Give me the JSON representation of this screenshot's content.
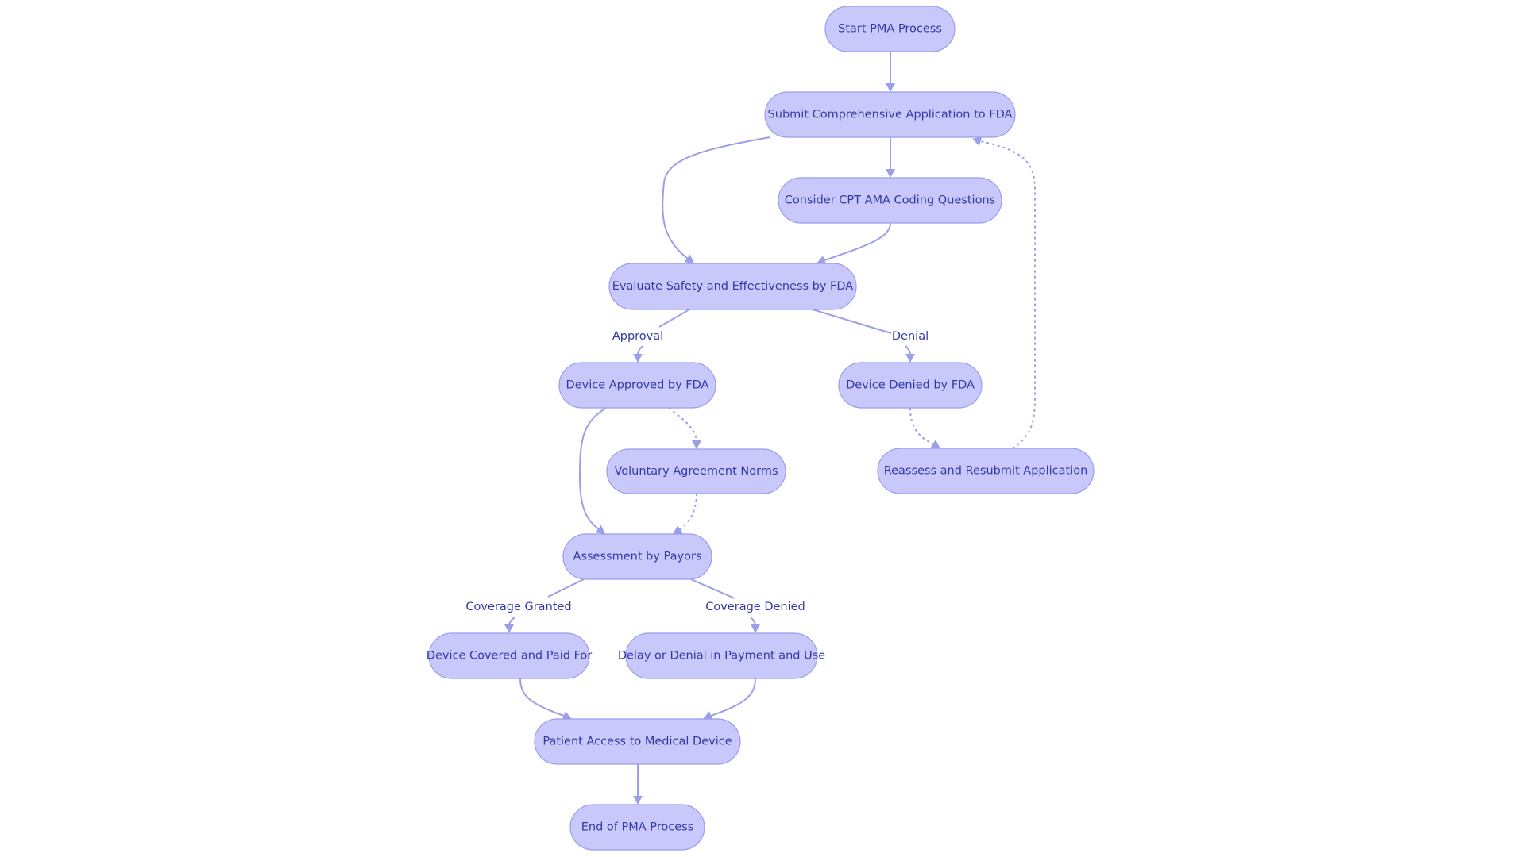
{
  "diagram": {
    "type": "flowchart",
    "direction": "top-to-bottom",
    "colors": {
      "node_fill": "#c8c9fa",
      "node_stroke": "#9b9dec",
      "node_text": "#3438a6",
      "edge": "#9c9eea"
    },
    "nodes": [
      {
        "id": "start",
        "label": "Start PMA Process"
      },
      {
        "id": "submit",
        "label": "Submit Comprehensive Application to FDA"
      },
      {
        "id": "consider",
        "label": "Consider CPT AMA Coding Questions"
      },
      {
        "id": "evaluate",
        "label": "Evaluate Safety and Effectiveness by FDA"
      },
      {
        "id": "approved",
        "label": "Device Approved by FDA"
      },
      {
        "id": "denied",
        "label": "Device Denied by FDA"
      },
      {
        "id": "voluntary",
        "label": "Voluntary Agreement Norms"
      },
      {
        "id": "reassess",
        "label": "Reassess and Resubmit Application"
      },
      {
        "id": "assessment",
        "label": "Assessment by Payors"
      },
      {
        "id": "covered",
        "label": "Device Covered and Paid For"
      },
      {
        "id": "delay",
        "label": "Delay or Denial in Payment and Use"
      },
      {
        "id": "patient",
        "label": "Patient Access to Medical Device"
      },
      {
        "id": "end",
        "label": "End of PMA Process"
      }
    ],
    "edges": [
      {
        "from": "start",
        "to": "submit",
        "label": "",
        "style": "solid"
      },
      {
        "from": "submit",
        "to": "consider",
        "label": "",
        "style": "solid"
      },
      {
        "from": "submit",
        "to": "evaluate",
        "label": "",
        "style": "solid"
      },
      {
        "from": "consider",
        "to": "evaluate",
        "label": "",
        "style": "solid"
      },
      {
        "from": "evaluate",
        "to": "approved",
        "label": "Approval",
        "style": "solid"
      },
      {
        "from": "evaluate",
        "to": "denied",
        "label": "Denial",
        "style": "solid"
      },
      {
        "from": "approved",
        "to": "voluntary",
        "label": "",
        "style": "dashed"
      },
      {
        "from": "approved",
        "to": "assessment",
        "label": "",
        "style": "solid"
      },
      {
        "from": "voluntary",
        "to": "assessment",
        "label": "",
        "style": "dashed"
      },
      {
        "from": "denied",
        "to": "reassess",
        "label": "",
        "style": "dashed"
      },
      {
        "from": "reassess",
        "to": "submit",
        "label": "",
        "style": "dashed"
      },
      {
        "from": "assessment",
        "to": "covered",
        "label": "Coverage Granted",
        "style": "solid"
      },
      {
        "from": "assessment",
        "to": "delay",
        "label": "Coverage Denied",
        "style": "solid"
      },
      {
        "from": "covered",
        "to": "patient",
        "label": "",
        "style": "solid"
      },
      {
        "from": "delay",
        "to": "patient",
        "label": "",
        "style": "solid"
      },
      {
        "from": "patient",
        "to": "end",
        "label": "",
        "style": "solid"
      }
    ]
  }
}
